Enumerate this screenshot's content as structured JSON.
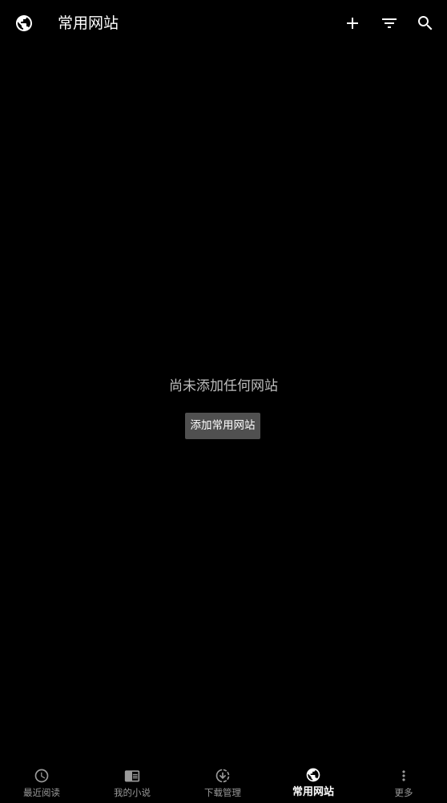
{
  "header": {
    "title": "常用网站",
    "leading_icon": "globe-icon",
    "actions": [
      {
        "icon": "add-icon"
      },
      {
        "icon": "filter-icon"
      },
      {
        "icon": "search-icon"
      }
    ]
  },
  "empty_state": {
    "message": "尚未添加任何网站",
    "button_label": "添加常用网站"
  },
  "bottom_nav": {
    "items": [
      {
        "label": "最近阅读",
        "icon": "clock-icon",
        "active": false
      },
      {
        "label": "我的小说",
        "icon": "book-icon",
        "active": false
      },
      {
        "label": "下载管理",
        "icon": "download-icon",
        "active": false
      },
      {
        "label": "常用网站",
        "icon": "globe-icon",
        "active": true
      },
      {
        "label": "更多",
        "icon": "more-vertical-icon",
        "active": false
      }
    ]
  },
  "colors": {
    "background": "#000000",
    "text_primary": "#ffffff",
    "text_secondary": "#bdbdbd",
    "nav_inactive": "#9a9a9a",
    "button_bg": "#505050"
  }
}
